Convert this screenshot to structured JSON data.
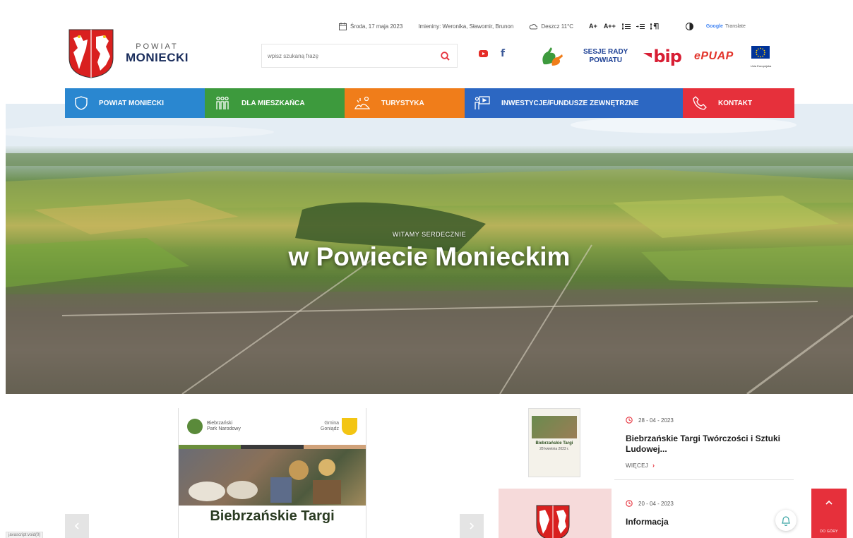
{
  "header": {
    "logo_small": "POWIAT",
    "logo_big": "MONIECKI",
    "date": "Środa, 17 maja 2023",
    "nameday": "Imieniny: Weronika, Sławomir, Brunon",
    "weather": "Deszcz 11°C",
    "font_controls": [
      "A+",
      "A++"
    ],
    "translate_brand": "Google",
    "translate_label": "Translate",
    "search_placeholder": "wpisz szukaną frazę"
  },
  "partners": {
    "sesje_line1": "SESJE RADY",
    "sesje_line2": "POWIATU",
    "bip": "bip",
    "epuap": "ePUAP",
    "eu_label": "Unia Europejska"
  },
  "nav": [
    {
      "label": "POWIAT MONIECKI",
      "color": "#2a87d0"
    },
    {
      "label": "DLA MIESZKAŃCA",
      "color": "#3d9a3d"
    },
    {
      "label": "TURYSTYKA",
      "color": "#f07d1a"
    },
    {
      "label": "INWESTYCJE/FUNDUSZE ZEWNĘTRZNE",
      "color": "#2c67c2"
    },
    {
      "label": "KONTAKT",
      "color": "#e6303b"
    }
  ],
  "hero": {
    "kicker": "WITAMY SERDECZNIE",
    "title": "w Powiecie Monieckim"
  },
  "poster": {
    "org_line1": "Biebrzański",
    "org_line2": "Park Narodowy",
    "gmina_line1": "Gmina",
    "gmina_line2": "Goniądz",
    "title": "Biebrzańskie Targi"
  },
  "thumb": {
    "title": "Biebrzańskie Targi",
    "date": "28 kwietnia 2023 r."
  },
  "news": [
    {
      "date": "28 - 04 - 2023",
      "title": "Biebrzańskie Targi Twórczości i Sztuki Ludowej...",
      "more": "WIĘCEJ"
    },
    {
      "date": "20 - 04 - 2023",
      "title": "Informacja"
    }
  ],
  "top_button_label": "DO GÓRY",
  "status_text": "javascript:void(0)"
}
